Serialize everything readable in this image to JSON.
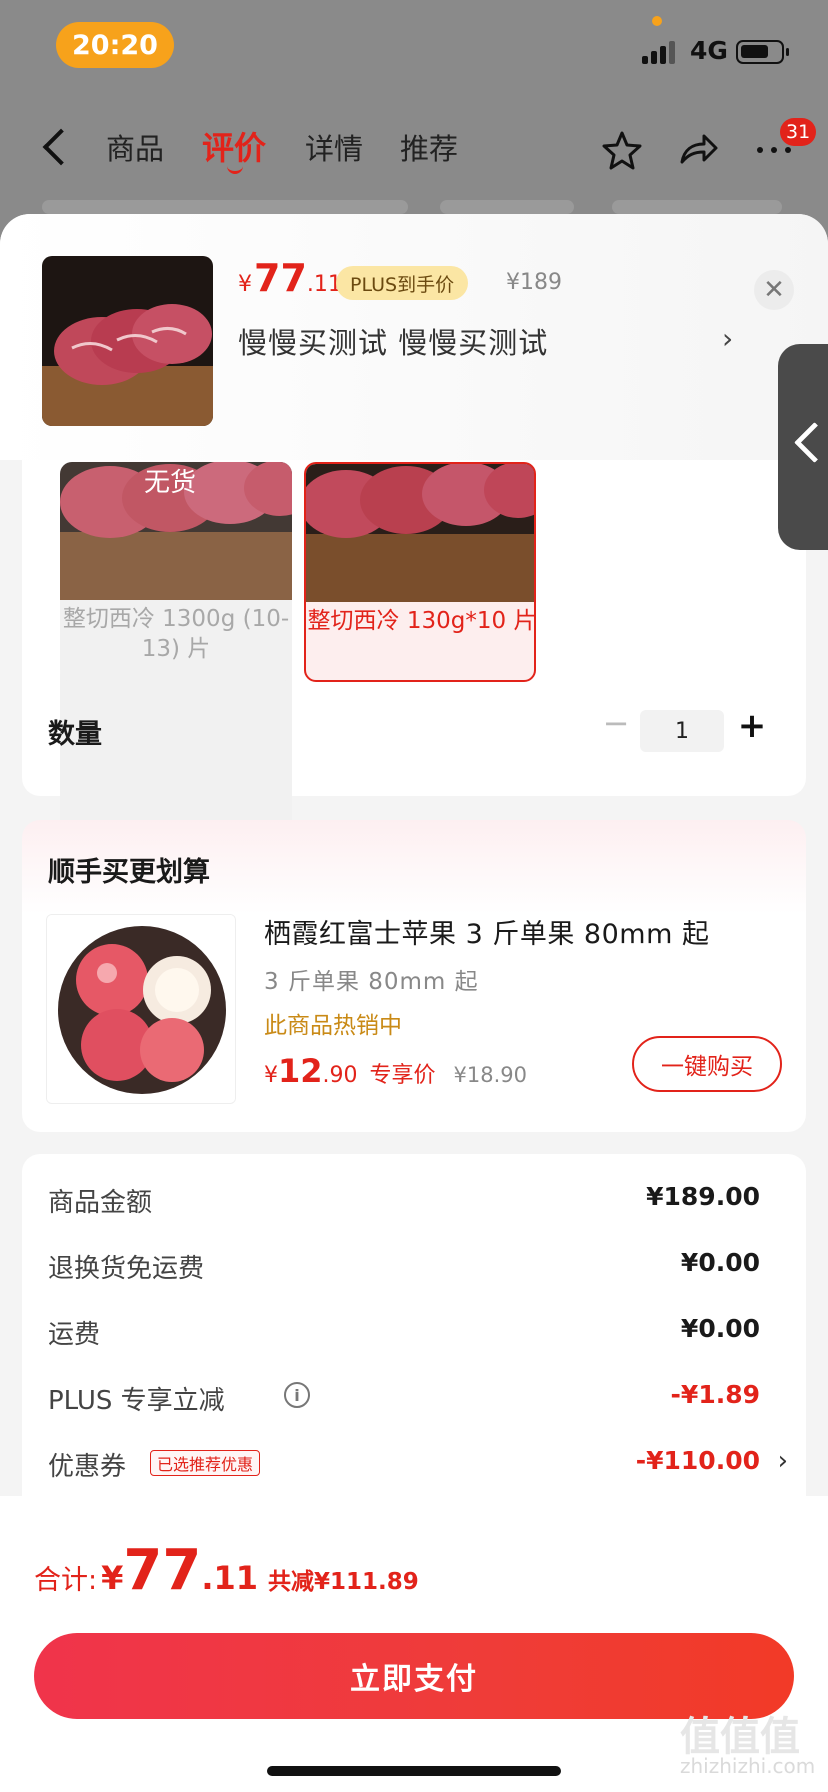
{
  "status": {
    "time": "20:20",
    "network": "4G"
  },
  "nav": {
    "tabs": [
      "商品",
      "评价",
      "详情",
      "推荐"
    ],
    "active_tab": "评价",
    "badge": "31"
  },
  "header": {
    "price_currency": "¥",
    "price_int": "77",
    "price_dec": ".11",
    "plus_tag": "PLUS到手价",
    "original_price": "¥189",
    "selected_spec": "慢慢买测试  慢慢买测试"
  },
  "specs": [
    {
      "label": "整切西冷 1300g (10-13) 片",
      "status": "无货",
      "selected": false
    },
    {
      "label": "整切西冷 130g*10 片",
      "selected": true
    }
  ],
  "quantity": {
    "label": "数量",
    "value": "1"
  },
  "recommend": {
    "title": "顺手买更划算",
    "name": "栖霞红富士苹果 3 斤单果 80mm 起",
    "sub": "3 斤单果 80mm 起",
    "hot": "此商品热销中",
    "price_currency": "¥",
    "price_int": "12",
    "price_dec": ".90",
    "exclusive": "专享价",
    "old_price": "¥18.90",
    "buy_label": "一键购买"
  },
  "fees": [
    {
      "key": "商品金额",
      "value": "¥189.00"
    },
    {
      "key": "退换货免运费",
      "value": "¥0.00"
    },
    {
      "key": "运费",
      "value": "¥0.00"
    },
    {
      "key": "PLUS 专享立减",
      "value": "-¥1.89"
    },
    {
      "key": "优惠券",
      "value": "-¥110.00",
      "tag": "已选推荐优惠"
    }
  ],
  "total": {
    "label": "合计:",
    "currency": "¥",
    "int": "77",
    "dec": ".11",
    "savings": "共减¥111.89"
  },
  "pay_label": "立即支付",
  "watermark": {
    "brand": "值值值",
    "site": "zhizhizhi.com"
  },
  "colors": {
    "accent": "#e2231a",
    "plus_tag_bg": "#fbe6a4",
    "status_pill": "#f7a21b",
    "hot_text": "#c98a16"
  }
}
